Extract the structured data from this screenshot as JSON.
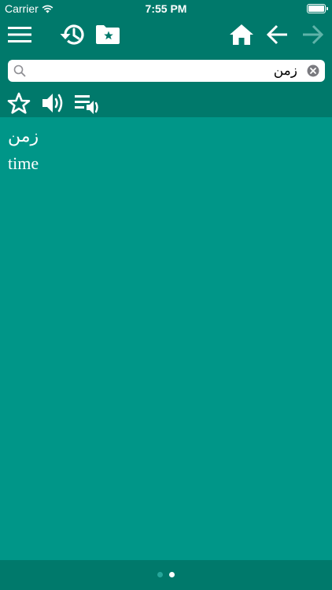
{
  "status_bar": {
    "carrier": "Carrier",
    "time": "7:55 PM",
    "icons": [
      "wifi-icon",
      "battery-icon"
    ]
  },
  "toolbar": {
    "icons": [
      "menu-icon",
      "history-icon",
      "favorites-folder-icon",
      "home-icon",
      "back-arrow-icon",
      "forward-arrow-icon"
    ],
    "forward_enabled": false
  },
  "search": {
    "value": "زمن",
    "icons": [
      "search-icon",
      "clear-icon"
    ]
  },
  "actions": {
    "icons": [
      "star-icon",
      "speaker-icon",
      "playlist-audio-icon"
    ]
  },
  "entry": {
    "headword": "زمن",
    "translation": "time"
  },
  "pager": {
    "pages": 2,
    "current": 2
  },
  "colors": {
    "background": "#009688",
    "bar": "#00796b",
    "text": "#ffffff"
  }
}
